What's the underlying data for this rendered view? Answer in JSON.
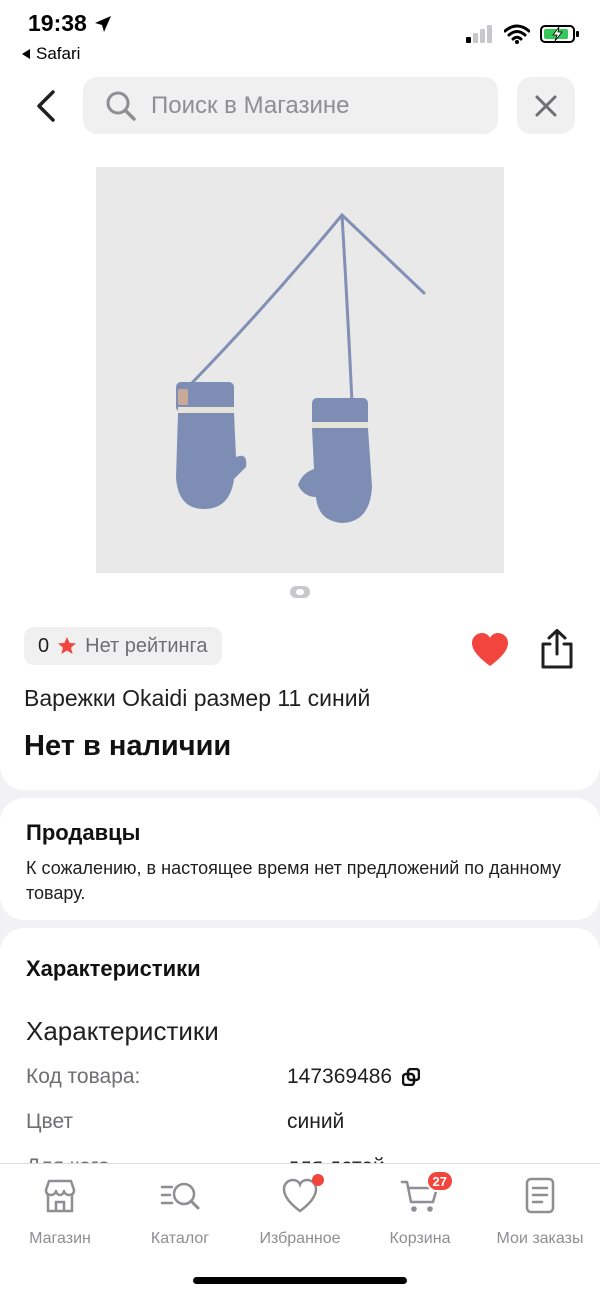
{
  "status": {
    "time": "19:38",
    "back_app": "Safari"
  },
  "search": {
    "placeholder": "Поиск в Магазине"
  },
  "product": {
    "rating_value": "0",
    "rating_text": "Нет рейтинга",
    "title": "Варежки Okaidi размер 11 синий",
    "availability": "Нет в наличии"
  },
  "sellers": {
    "heading": "Продавцы",
    "message": "К сожалению, в настоящее время нет предложений по данному товару."
  },
  "specs": {
    "heading": "Характеристики",
    "subheading": "Характеристики",
    "rows": [
      {
        "key": "Код товара:",
        "value": "147369486"
      },
      {
        "key": "Цвет",
        "value": "синий"
      },
      {
        "key": "Для кого",
        "value": "для детей"
      }
    ]
  },
  "tabs": [
    {
      "label": "Магазин",
      "icon": "store-icon"
    },
    {
      "label": "Каталог",
      "icon": "catalog-search-icon"
    },
    {
      "label": "Избранное",
      "icon": "heart-icon",
      "dot": true
    },
    {
      "label": "Корзина",
      "icon": "cart-icon",
      "badge": "27"
    },
    {
      "label": "Мои заказы",
      "icon": "orders-icon"
    }
  ],
  "colors": {
    "accent_red": "#f2453d",
    "rating_star": "#f2453d",
    "favorite_heart": "#f2453d",
    "mitten": "#7d8db3"
  }
}
